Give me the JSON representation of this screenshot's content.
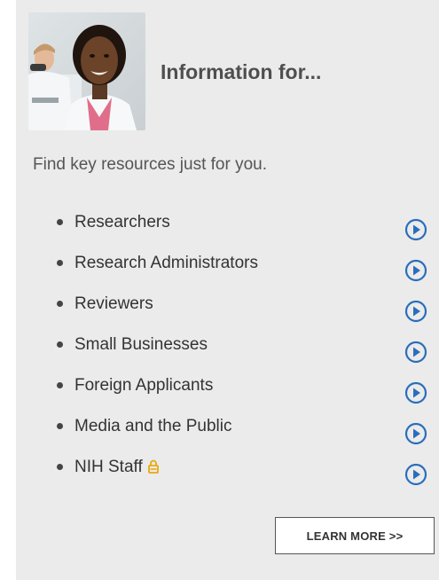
{
  "panel": {
    "title": "Information for...",
    "intro": "Find key resources just for you.",
    "photo_icon": "researcher-photo"
  },
  "audiences": [
    {
      "label": "Researchers",
      "locked": false
    },
    {
      "label": "Research Administrators",
      "locked": false
    },
    {
      "label": "Reviewers",
      "locked": false
    },
    {
      "label": "Small Businesses",
      "locked": false
    },
    {
      "label": "Foreign Applicants",
      "locked": false
    },
    {
      "label": "Media and the Public",
      "locked": false
    },
    {
      "label": "NIH Staff",
      "locked": true
    }
  ],
  "learn_more": {
    "label": "LEARN MORE >>"
  },
  "colors": {
    "panel_bg": "#ebebeb",
    "arrow_blue": "#2a6ebb",
    "lock_gold": "#e8a90c"
  },
  "icons": {
    "go": "play-circle-icon",
    "lock": "lock-icon"
  }
}
